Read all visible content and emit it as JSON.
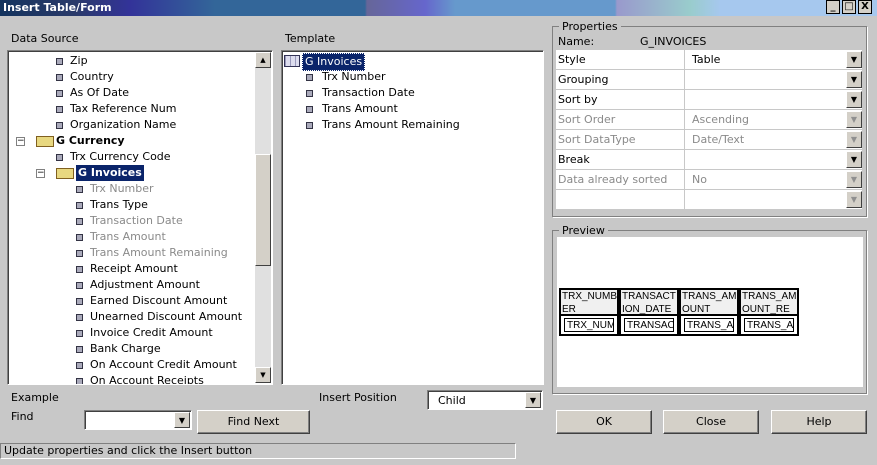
{
  "window": {
    "title": "Insert Table/Form",
    "minimize": "_",
    "maximize": "□",
    "close": "X"
  },
  "data_source": {
    "label": "Data Source",
    "items": [
      {
        "label": "Zip",
        "level": 2,
        "type": "field",
        "gray": false
      },
      {
        "label": "Country",
        "level": 2,
        "type": "field",
        "gray": false
      },
      {
        "label": "As Of Date",
        "level": 2,
        "type": "field",
        "gray": false
      },
      {
        "label": "Tax Reference Num",
        "level": 2,
        "type": "field",
        "gray": false
      },
      {
        "label": "Organization Name",
        "level": 2,
        "type": "field",
        "gray": false
      },
      {
        "label": "G Currency",
        "level": 1,
        "type": "group",
        "gray": false
      },
      {
        "label": "Trx Currency Code",
        "level": 2,
        "type": "field",
        "gray": false
      },
      {
        "label": "G Invoices",
        "level": 2,
        "type": "group",
        "gray": false,
        "selected": true
      },
      {
        "label": "Trx Number",
        "level": 3,
        "type": "field",
        "gray": true
      },
      {
        "label": "Trans Type",
        "level": 3,
        "type": "field",
        "gray": false
      },
      {
        "label": "Transaction Date",
        "level": 3,
        "type": "field",
        "gray": true
      },
      {
        "label": "Trans Amount",
        "level": 3,
        "type": "field",
        "gray": true
      },
      {
        "label": "Trans Amount Remaining",
        "level": 3,
        "type": "field",
        "gray": true
      },
      {
        "label": "Receipt Amount",
        "level": 3,
        "type": "field",
        "gray": false
      },
      {
        "label": "Adjustment Amount",
        "level": 3,
        "type": "field",
        "gray": false
      },
      {
        "label": "Earned Discount Amount",
        "level": 3,
        "type": "field",
        "gray": false
      },
      {
        "label": "Unearned Discount Amount",
        "level": 3,
        "type": "field",
        "gray": false
      },
      {
        "label": "Invoice Credit Amount",
        "level": 3,
        "type": "field",
        "gray": false
      },
      {
        "label": "Bank Charge",
        "level": 3,
        "type": "field",
        "gray": false
      },
      {
        "label": "On Account Credit Amount",
        "level": 3,
        "type": "field",
        "gray": false
      },
      {
        "label": "On Account Receipts",
        "level": 3,
        "type": "field",
        "gray": false
      }
    ]
  },
  "template": {
    "label": "Template",
    "root": "G Invoices",
    "items": [
      "Trx Number",
      "Transaction Date",
      "Trans Amount",
      "Trans Amount Remaining"
    ]
  },
  "properties": {
    "label": "Properties",
    "name_label": "Name:",
    "name_value": "G_INVOICES",
    "rows": [
      {
        "key": "Style",
        "value": "Table",
        "disabled": false
      },
      {
        "key": "Grouping",
        "value": "",
        "disabled": false
      },
      {
        "key": "Sort by",
        "value": "",
        "disabled": false
      },
      {
        "key": "Sort Order",
        "value": "Ascending",
        "disabled": true
      },
      {
        "key": "Sort DataType",
        "value": "Date/Text",
        "disabled": true
      },
      {
        "key": "Break",
        "value": "",
        "disabled": false
      },
      {
        "key": "Data already sorted",
        "value": "No",
        "disabled": true
      },
      {
        "key": "",
        "value": "",
        "disabled": true
      }
    ]
  },
  "preview": {
    "label": "Preview",
    "headers": [
      "TRX_NUMBER",
      "TRANSACTION_DATE",
      "TRANS_AMOUNT",
      "TRANS_AMOUNT_REMAINING"
    ],
    "cells": [
      "TRX_NUM",
      "TRANSAC",
      "TRANS_A",
      "TRANS_A"
    ]
  },
  "example_label": "Example",
  "find": {
    "label": "Find",
    "value": "",
    "button": "Find Next"
  },
  "insert_position": {
    "label": "Insert Position",
    "value": "Child"
  },
  "buttons": {
    "ok": "OK",
    "close": "Close",
    "help": "Help"
  },
  "status": "Update properties and click the Insert button"
}
